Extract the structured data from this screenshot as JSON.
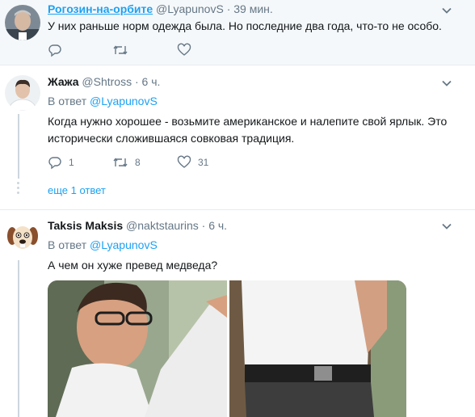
{
  "tweets": [
    {
      "name": "Рогозин-на-орбите",
      "handle": "@LyapunovS",
      "separator": "·",
      "time": "39 мин.",
      "text": "У них раньше норм одежда была. Но последние два года, что-то не особо."
    },
    {
      "name": "Жажа",
      "handle": "@Shtross",
      "separator": "·",
      "time": "6 ч.",
      "reply_prefix": "В ответ",
      "reply_to": "@LyapunovS",
      "text": "Когда нужно хорошее - возьмите американское и налепите свой ярлык. Это исторически сложившаяся совковая традиция.",
      "replies": "1",
      "retweets": "8",
      "likes": "31",
      "more_replies": "еще 1 ответ"
    },
    {
      "name": "Taksis Maksis",
      "handle": "@naktstaurins",
      "separator": "·",
      "time": "6 ч.",
      "reply_prefix": "В ответ",
      "reply_to": "@LyapunovS",
      "text": "А чем он хуже превед медведа?"
    }
  ],
  "colors": {
    "accent": "#1da1f2",
    "secondary_text": "#657786",
    "highlight_background": "#f5f8fa"
  }
}
